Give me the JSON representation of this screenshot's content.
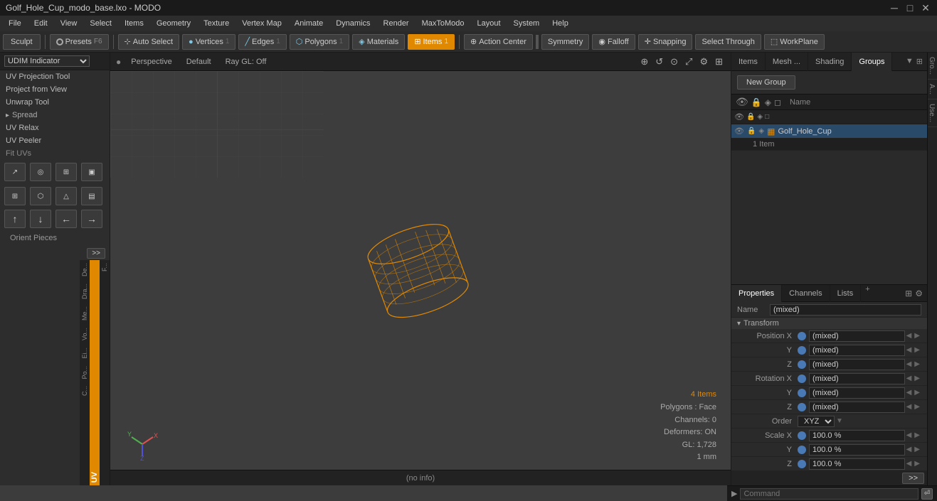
{
  "titlebar": {
    "title": "Golf_Hole_Cup_modo_base.lxo - MODO",
    "controls": [
      "─",
      "□",
      "✕"
    ]
  },
  "menubar": {
    "items": [
      "File",
      "Edit",
      "View",
      "Select",
      "Items",
      "Geometry",
      "Texture",
      "Vertex Map",
      "Animate",
      "Dynamics",
      "Render",
      "MaxToModo",
      "Layout",
      "System",
      "Help"
    ]
  },
  "toolbar": {
    "sculpt_label": "Sculpt",
    "presets_label": "Presets",
    "presets_shortcut": "F6",
    "auto_select_label": "Auto Select",
    "vertices_label": "Vertices",
    "vertices_count": "1",
    "edges_label": "Edges",
    "edges_count": "1",
    "polygons_label": "Polygons",
    "polygons_count": "1",
    "materials_label": "Materials",
    "items_label": "Items",
    "items_count": "1",
    "action_center_label": "Action Center",
    "symmetry_label": "Symmetry",
    "falloff_label": "Falloff",
    "snapping_label": "Snapping",
    "select_through_label": "Select Through",
    "workplane_label": "WorkPlane"
  },
  "left_panel": {
    "dropdown": "UDIM Indicator",
    "items": [
      "UV Projection Tool",
      "Project from View",
      "Unwrap Tool"
    ],
    "section": "Spread",
    "subsections": [
      "UV Relax",
      "UV Peeler",
      "Fit UVs"
    ],
    "uv_tab": "UV",
    "orient_label": "Orient Pieces"
  },
  "viewport": {
    "mode": "Perspective",
    "shading": "Default",
    "ray_gl": "Ray GL: Off",
    "stats": {
      "items": "4 Items",
      "polygons": "Polygons : Face",
      "channels": "Channels: 0",
      "deformers": "Deformers: ON",
      "gl": "GL: 1,728",
      "unit": "1 mm"
    },
    "status_bar": "(no info)"
  },
  "right_panel": {
    "tabs": [
      "Items",
      "Mesh ...",
      "Shading",
      "Groups"
    ],
    "active_tab": "Groups",
    "new_group_label": "New Group",
    "list_header": {
      "name_col": "Name"
    },
    "items_list": [
      {
        "name": "Golf_Hole_Cup",
        "count": "1 Item",
        "selected": true
      }
    ]
  },
  "properties": {
    "tabs": [
      "Properties",
      "Channels",
      "Lists"
    ],
    "active_tab": "Properties",
    "add_tab_label": "+",
    "name_label": "Name",
    "name_value": "(mixed)",
    "section_transform": "Transform",
    "rows": [
      {
        "label": "Position X",
        "value": "(mixed)"
      },
      {
        "label": "Y",
        "value": "(mixed)"
      },
      {
        "label": "Z",
        "value": "(mixed)"
      },
      {
        "label": "Rotation X",
        "value": "(mixed)"
      },
      {
        "label": "Y",
        "value": "(mixed)"
      },
      {
        "label": "Z",
        "value": "(mixed)"
      },
      {
        "label": "Order",
        "value": "XYZ",
        "type": "select"
      },
      {
        "label": "Scale X",
        "value": "100.0 %"
      },
      {
        "label": "Y",
        "value": "100.0 %"
      },
      {
        "label": "Z",
        "value": "100.0 %"
      }
    ]
  },
  "command_bar": {
    "prompt": "▶",
    "placeholder": "Command"
  },
  "left_vert_tabs": [
    "De...",
    "Dra...",
    "Me...",
    "Vo...",
    "Ei...",
    "Po...",
    "C..."
  ],
  "right_vert_tabs": [
    "Gro...",
    "A...",
    "Use..."
  ]
}
